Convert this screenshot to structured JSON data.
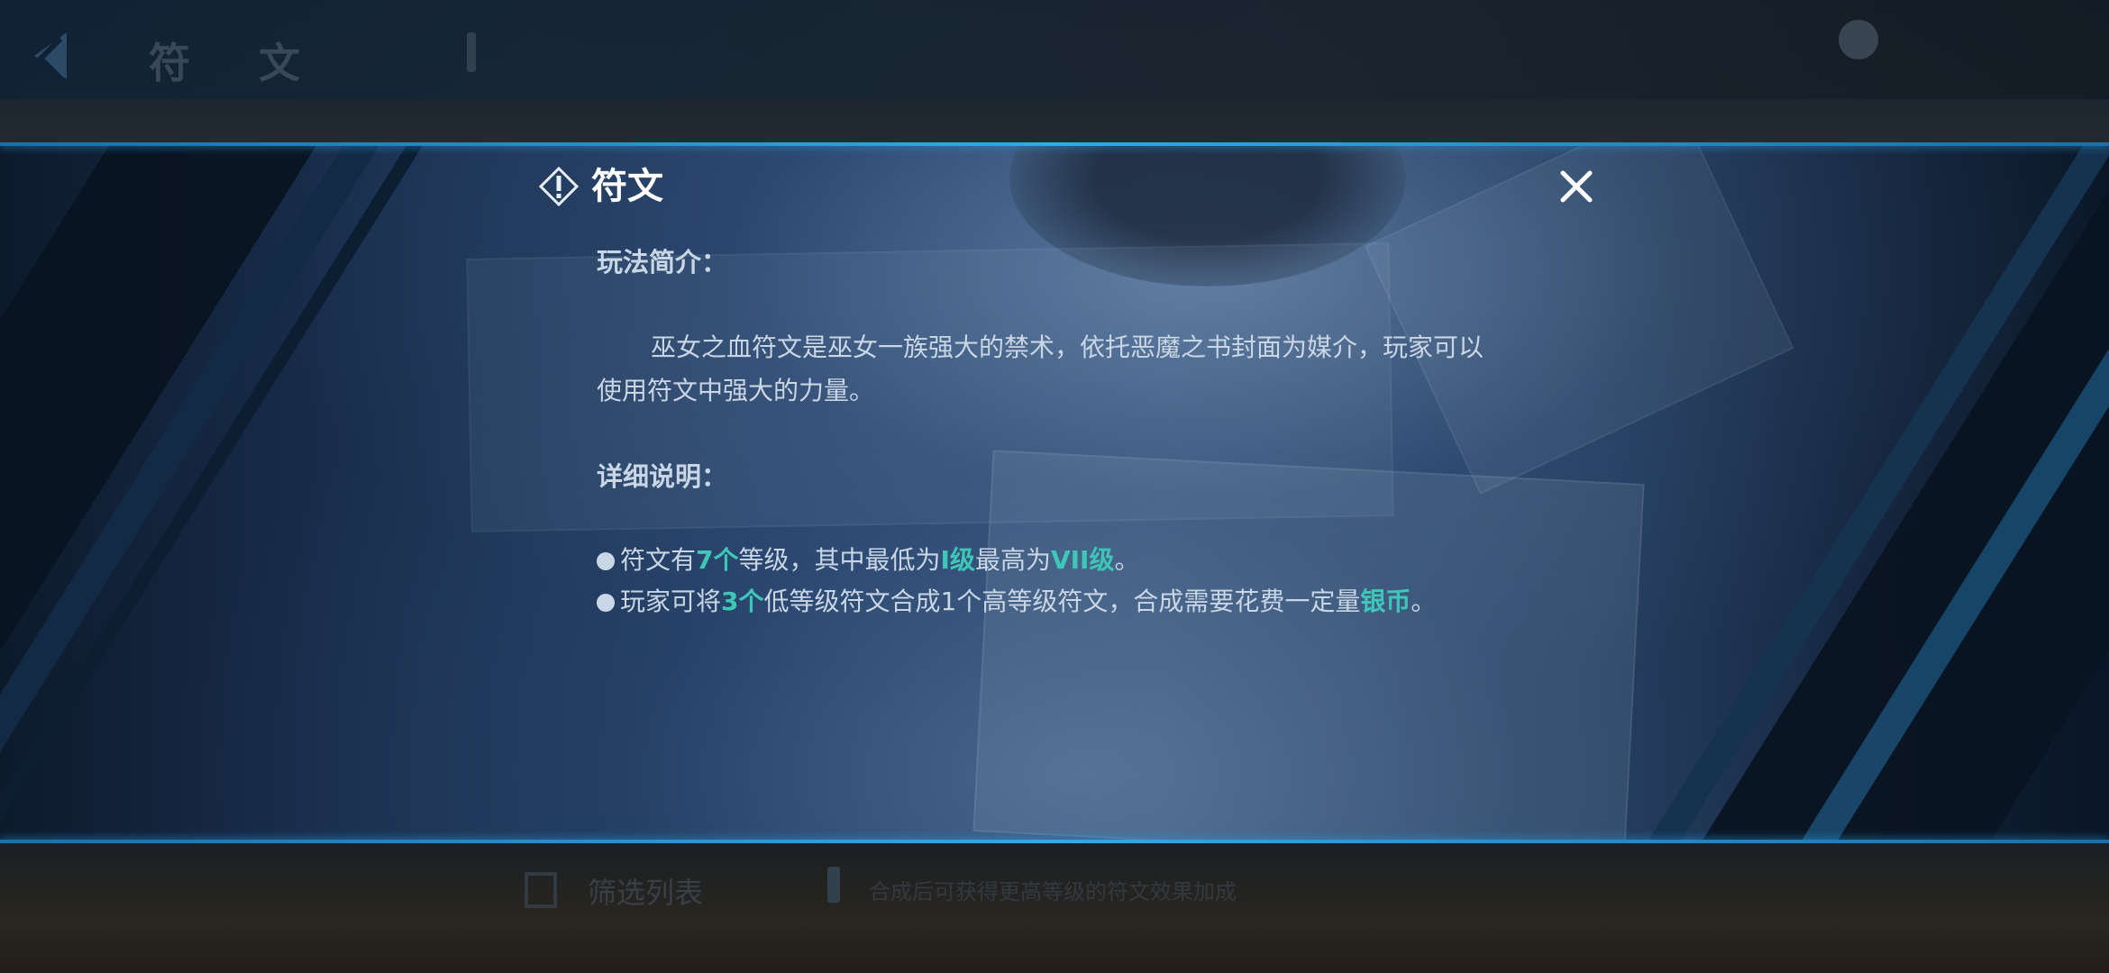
{
  "background": {
    "nav_title": "符 文",
    "filter_label": "筛选列表",
    "tip_text": "合成后可获得更高等级的符文效果加成"
  },
  "dialog": {
    "title": "符文",
    "intro_heading": "玩法简介：",
    "intro_text": "巫女之血符文是巫女一族强大的禁术，依托恶魔之书封面为媒介，玩家可以使用符文中强大的力量。",
    "detail_heading": "详细说明：",
    "bullet1": {
      "a": "符文有",
      "b": "7个",
      "c": "等级，其中最低为",
      "d": "I级",
      "e": "最高为",
      "f": "VII级",
      "g": "。"
    },
    "bullet2": {
      "a": "玩家可将",
      "b": "3个",
      "c": "低等级符文合成1个高等级符文，合成需要花费一定量",
      "d": "银币",
      "e": "。"
    },
    "highlight_color": "#3ec7b8"
  },
  "icons": {
    "header": "rune-info-icon",
    "close": "close-icon"
  }
}
